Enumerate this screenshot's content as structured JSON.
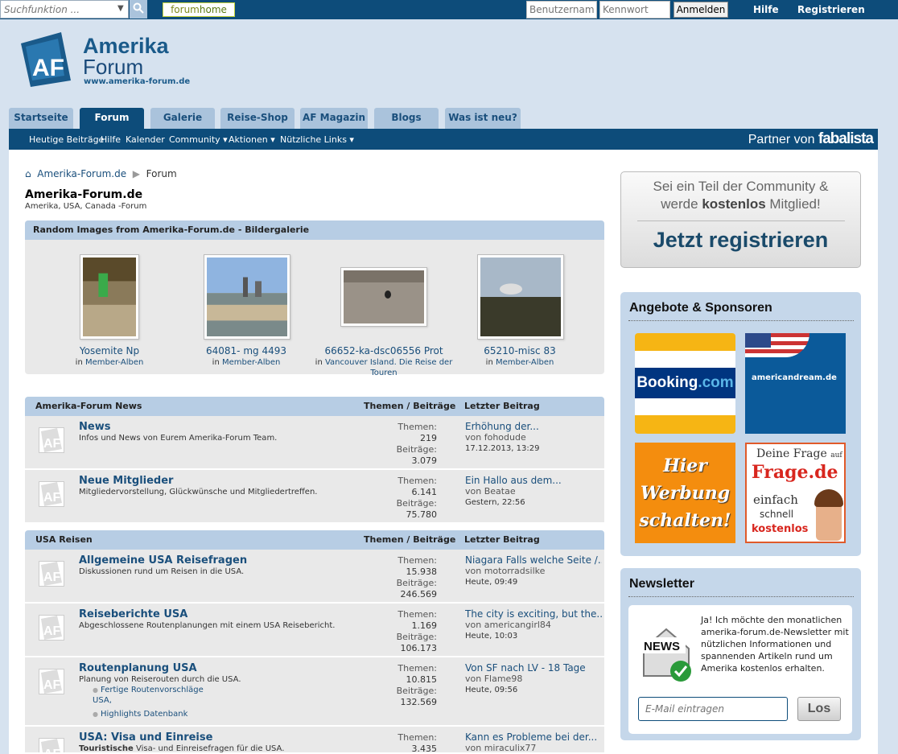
{
  "topbar": {
    "search_placeholder": "Suchfunktion ...",
    "forumhome_a": "forum",
    "forumhome_b": "home",
    "username_placeholder": "Benutzername",
    "password_placeholder": "Kennwort",
    "login_label": "Anmelden",
    "help_label": "Hilfe",
    "register_label": "Registrieren"
  },
  "header": {
    "logo_mark": "AF",
    "title": "Amerika",
    "subtitle": "Forum",
    "url": "www.amerika-forum.de"
  },
  "tabs": [
    {
      "label": "Startseite"
    },
    {
      "label": "Forum"
    },
    {
      "label": "Galerie"
    },
    {
      "label": "Reise-Shop"
    },
    {
      "label": "AF Magazin"
    },
    {
      "label": "Blogs"
    },
    {
      "label": "Was ist neu?"
    }
  ],
  "subnav": {
    "items": [
      "Heutige Beiträge",
      "Hilfe",
      "Kalender",
      "Community ▾",
      "Aktionen ▾",
      "Nützliche Links ▾"
    ],
    "partner_a": "Partner von ",
    "partner_b": "fabalista"
  },
  "breadcrumb": {
    "home": "Amerika-Forum.de",
    "current": "Forum"
  },
  "page": {
    "title": "Amerika-Forum.de",
    "desc": "Amerika, USA, Canada -Forum"
  },
  "gallery": {
    "heading": "Random Images from Amerika-Forum.de - Bildergalerie",
    "in_label": "in ",
    "items": [
      {
        "title": "Yosemite Np",
        "album": "Member-Alben"
      },
      {
        "title": "64081- mg 4493",
        "album": "Member-Alben"
      },
      {
        "title": "66652-ka-dsc06556 Prot",
        "album": "Vancouver Island. Die Reise der Touren"
      },
      {
        "title": "65210-misc 83",
        "album": "Member-Alben"
      }
    ]
  },
  "columns": {
    "stats": "Themen / Beiträge",
    "last": "Letzter Beitrag",
    "topics": "Themen:",
    "posts": "Beiträge:",
    "by": "von "
  },
  "sections": [
    {
      "title": "Amerika-Forum News",
      "forums": [
        {
          "name": "News",
          "desc": "Infos und News von Eurem Amerika-Forum Team.",
          "topics": "219",
          "posts": "3.079",
          "last_title": "Erhöhung der...",
          "last_by": "fohodude",
          "last_when": "17.12.2013, 13:29"
        },
        {
          "name": "Neue Mitglieder",
          "desc": "Mitgliedervorstellung, Glückwünsche und Mitgliedertreffen.",
          "topics": "6.141",
          "posts": "75.780",
          "last_title": "Ein Hallo aus dem...",
          "last_by": "Beatae",
          "last_when": "Gestern, 22:56"
        }
      ]
    },
    {
      "title": "USA Reisen",
      "forums": [
        {
          "name": "Allgemeine USA Reisefragen",
          "desc": "Diskussionen rund um Reisen in die USA.",
          "topics": "15.938",
          "posts": "246.569",
          "last_title": "Niagara Falls welche Seite /...",
          "last_by": "motorradsilke",
          "last_when": "Heute, 09:49"
        },
        {
          "name": "Reiseberichte USA",
          "desc": "Abgeschlossene Routenplanungen mit einem USA Reisebericht.",
          "topics": "1.169",
          "posts": "106.173",
          "last_title": "The city is exciting, but the...",
          "last_by": "americangirl84",
          "last_when": "Heute, 10:03"
        },
        {
          "name": "Routenplanung USA",
          "desc": "Planung von Reiserouten durch die USA.",
          "sub1": "Fertige Routenvorschläge",
          "sub1b": "USA,",
          "sub2": "Highlights Datenbank",
          "topics": "10.815",
          "posts": "132.569",
          "last_title": "Von SF nach LV - 18 Tage",
          "last_by": "Flame98",
          "last_when": "Heute, 09:56"
        },
        {
          "name": "USA: Visa und Einreise",
          "desc_b": "Touristische",
          "desc": " Visa- und Einreisefragen für die USA.",
          "topics": "3.435",
          "posts": "",
          "last_title": "Kann es Probleme bei der...",
          "last_by": "miraculix77",
          "last_when": ""
        }
      ]
    }
  ],
  "sidebar": {
    "register": {
      "line1": "Sei ein Teil der Community &",
      "line2_a": "werde ",
      "line2_b": "kostenlos",
      "line2_c": " Mitglied!",
      "cta": "Jetzt registrieren"
    },
    "sponsors": {
      "title": "Angebote & Sponsoren",
      "booking_a": "Booking",
      "booking_b": ".com",
      "american": "americandream.de",
      "werbung": [
        "Hier",
        "Werbung",
        "schalten!"
      ],
      "frage_1": "Deine Frage ",
      "frage_1s": "auf",
      "frage_2": "Frage.de",
      "frage_3": "einfach",
      "frage_4": "schnell",
      "frage_5": "kostenlos"
    },
    "newsletter": {
      "title": "Newsletter",
      "icon_text": "NEWS",
      "text": "Ja! Ich möchte den monatlichen amerika-forum.de-Newsletter mit nützlichen Informationen und spannenden Artikeln rund um Amerika kostenlos erhalten.",
      "email_placeholder": "E-Mail eintragen",
      "button": "Los"
    }
  }
}
